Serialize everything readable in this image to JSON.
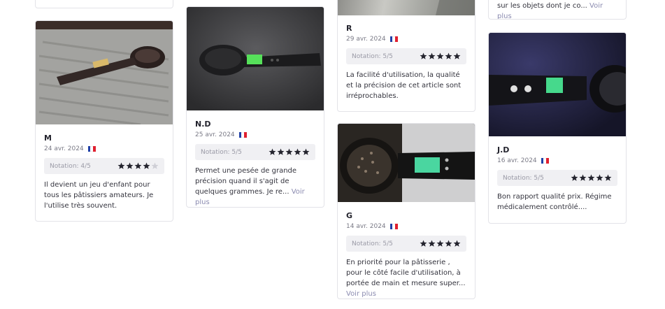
{
  "reviews": [
    {
      "author": "M",
      "date": "24 avr. 2024",
      "rating_label": "Notation: 4/5",
      "rating": 4,
      "text": "Il devient un jeu d'enfant pour tous les pâtissiers amateurs. Je l'utilise très souvent.",
      "more": ""
    },
    {
      "author": "N.D",
      "date": "25 avr. 2024",
      "rating_label": "Notation: 5/5",
      "rating": 5,
      "text": "Permet une pesée de grande précision quand il s'agit de quelques grammes. Je re...",
      "more": "Voir plus"
    },
    {
      "author": "R",
      "date": "29 avr. 2024",
      "rating_label": "Notation: 5/5",
      "rating": 5,
      "text": "La facilité d'utilisation, la qualité et la précision de cet article sont irréprochables.",
      "more": ""
    },
    {
      "author": "G",
      "date": "14 avr. 2024",
      "rating_label": "Notation: 5/5",
      "rating": 5,
      "text": "En priorité pour la pâtisserie , pour le côté facile d'utilisation, à portée de main et mesure super...",
      "more": "Voir plus"
    },
    {
      "author": "J.D",
      "date": "16 avr. 2024",
      "rating_label": "Notation: 5/5",
      "rating": 5,
      "text": "Bon rapport qualité prix. Régime médicalement contrôlé....",
      "more": ""
    }
  ],
  "partial_top_right": {
    "text": "sur les objets dont je co...",
    "more": "Voir plus"
  },
  "colors": {
    "star_filled": "#24242e",
    "star_empty": "#cfcfd6",
    "flag": [
      "#1f3fa6",
      "#ffffff",
      "#e0202f"
    ]
  },
  "icons": [
    "star-icon",
    "flag-fr-icon"
  ]
}
